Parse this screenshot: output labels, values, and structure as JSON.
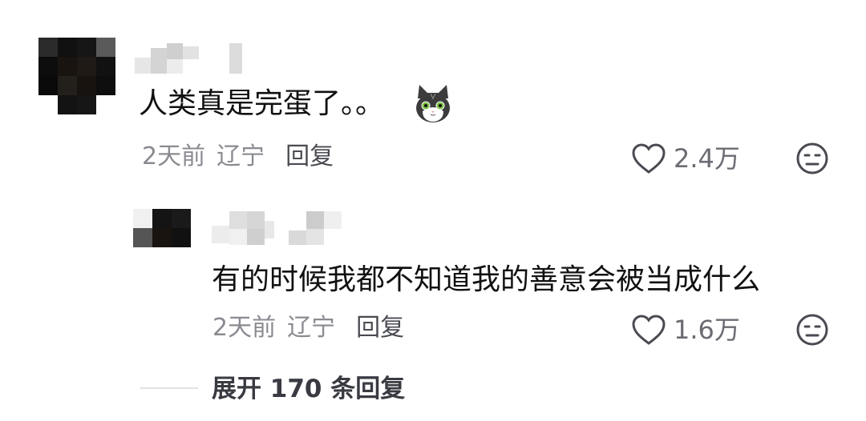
{
  "comments": [
    {
      "text": "人类真是完蛋了。。",
      "emoji_icon": "grey-cat-sticker",
      "time": "2天前",
      "location": "辽宁",
      "reply_label": "回复",
      "like_count": "2.4万"
    }
  ],
  "replies": [
    {
      "text": "有的时候我都不知道我的善意会被当成什么",
      "time": "2天前",
      "location": "辽宁",
      "reply_label": "回复",
      "like_count": "1.6万"
    }
  ],
  "expand_label": "展开 170 条回复",
  "icons": {
    "like": "heart-outline-icon",
    "dislike": "unhappy-face-icon"
  },
  "colors": {
    "text_primary": "#111111",
    "text_secondary": "#8a8b91",
    "icon": "#4a4b52"
  }
}
